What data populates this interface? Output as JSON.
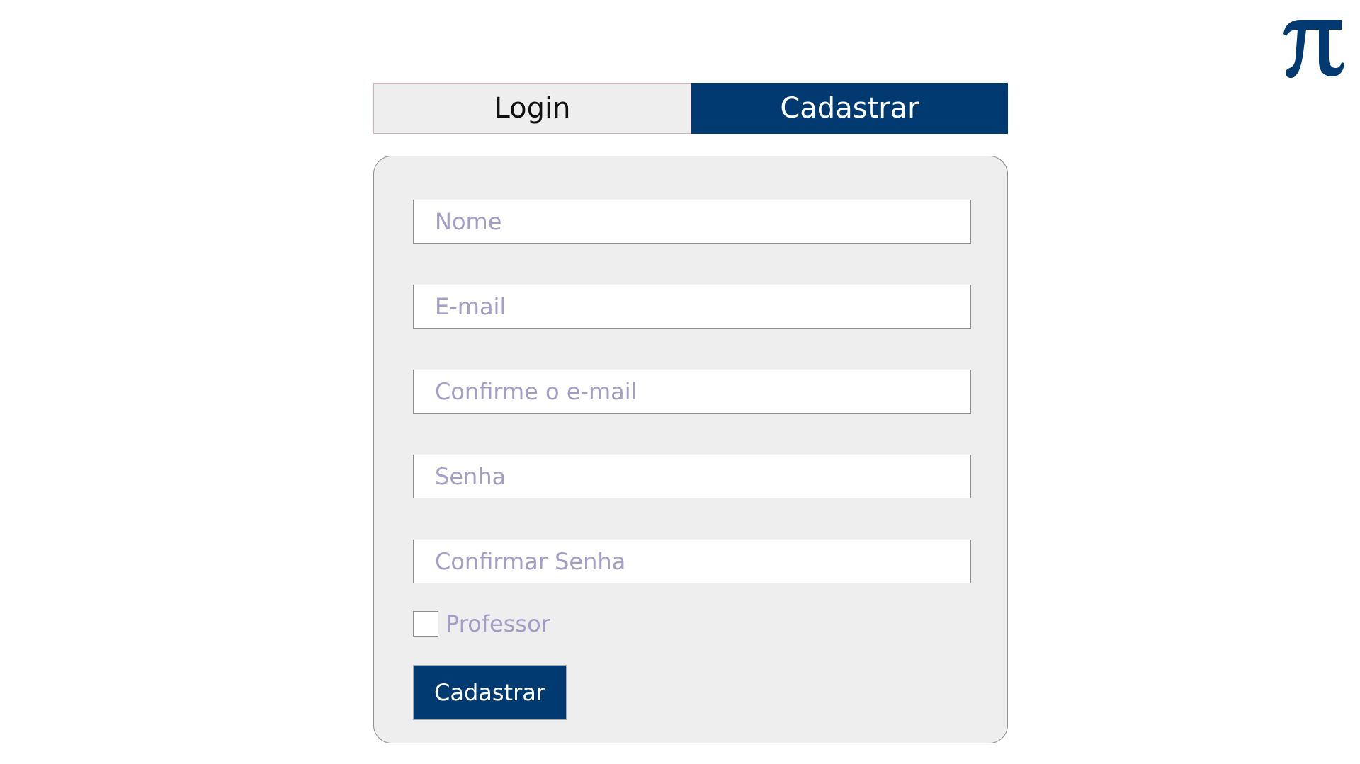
{
  "brand": {
    "logo_icon": "pi-icon",
    "color": "#003a70"
  },
  "tabs": [
    {
      "label": "Login",
      "active": false
    },
    {
      "label": "Cadastrar",
      "active": true
    }
  ],
  "form": {
    "fields": [
      {
        "placeholder": "Nome",
        "value": ""
      },
      {
        "placeholder": "E-mail",
        "value": ""
      },
      {
        "placeholder": "Confirme o e-mail",
        "value": ""
      },
      {
        "placeholder": "Senha",
        "value": ""
      },
      {
        "placeholder": "Confirmar Senha",
        "value": ""
      }
    ],
    "checkbox": {
      "label": "Professor",
      "checked": false
    },
    "submit_label": "Cadastrar"
  }
}
